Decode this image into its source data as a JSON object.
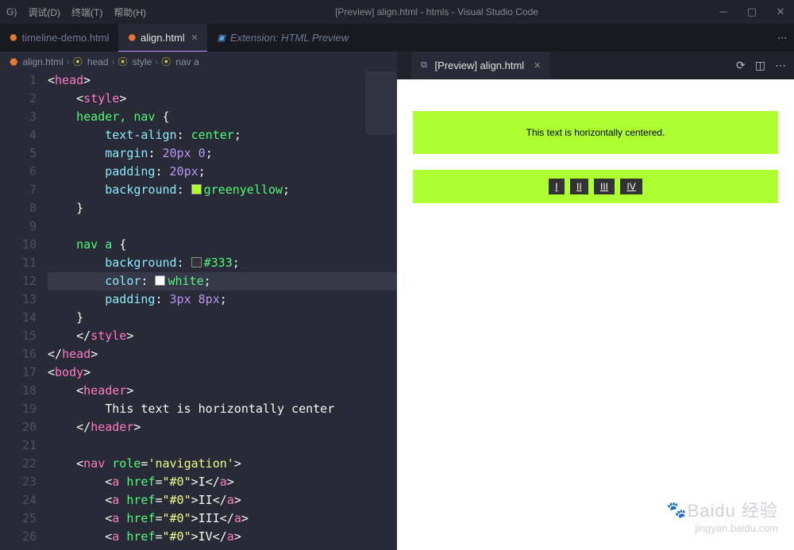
{
  "window": {
    "menu": [
      "G)",
      "调试(D)",
      "终端(T)",
      "帮助(H)"
    ],
    "title": "[Preview] align.html - htmls - Visual Studio Code"
  },
  "tabs": [
    {
      "icon": "⬣",
      "icon_class": "orangeico",
      "label": "timeline-demo.html",
      "active": false,
      "italic": false,
      "close": false
    },
    {
      "icon": "⬣",
      "icon_class": "orangeico",
      "label": "align.html",
      "active": true,
      "italic": false,
      "close": true
    },
    {
      "icon": "▣",
      "icon_class": "blueico",
      "label": "Extension: HTML Preview",
      "active": false,
      "italic": true,
      "close": false
    }
  ],
  "breadcrumb": {
    "file": "align.html",
    "path": [
      "head",
      "style",
      "nav a"
    ]
  },
  "code": {
    "lines": [
      1,
      2,
      3,
      4,
      5,
      6,
      7,
      8,
      9,
      10,
      11,
      12,
      13,
      14,
      15,
      16,
      17,
      18,
      19,
      20,
      21,
      22,
      23,
      24,
      25,
      26
    ],
    "currentLine": 12
  },
  "editorText": {
    "l1": "head",
    "l2": "style",
    "l3sel": "header, nav",
    "l4p": "text-align",
    "l4v": "center",
    "l5p": "margin",
    "l5v1": "20px",
    "l5v2": "0",
    "l6p": "padding",
    "l6v": "20px",
    "l7p": "background",
    "l7v": "greenyellow",
    "l7c": "#adff2f",
    "l10sel": "nav a",
    "l11p": "background",
    "l11v": "#333",
    "l11c": "#333333",
    "l12p": "color",
    "l12v": "white",
    "l12c": "#ffffff",
    "l13p": "padding",
    "l13v1": "3px",
    "l13v2": "8px",
    "l17": "body",
    "l18": "header",
    "l19text": "This text is horizontally center",
    "l22tag": "nav",
    "l22attr": "role",
    "l22val": "'navigation'",
    "rows": [
      {
        "tag": "a",
        "href": "\"#0\"",
        "txt": "I"
      },
      {
        "tag": "a",
        "href": "\"#0\"",
        "txt": "II"
      },
      {
        "tag": "a",
        "href": "\"#0\"",
        "txt": "III"
      },
      {
        "tag": "a",
        "href": "\"#0\"",
        "txt": "IV"
      }
    ]
  },
  "preview": {
    "tabLabel": "[Preview] align.html",
    "headerText": "This text is horizontally centered.",
    "nav": [
      "I",
      "II",
      "III",
      "IV"
    ]
  },
  "watermark": {
    "brand": "Baidu 经验",
    "sub": "jingyan.baidu.com"
  }
}
